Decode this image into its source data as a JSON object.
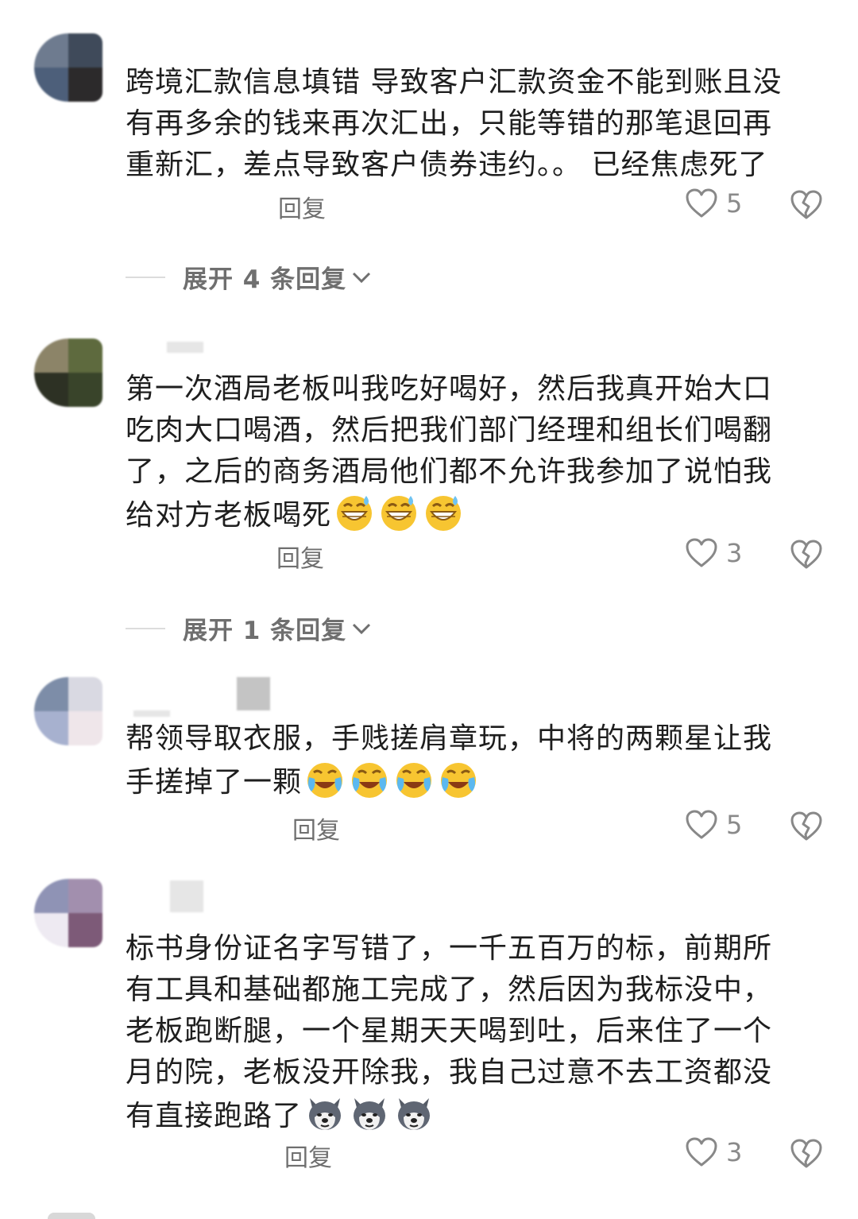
{
  "comments": [
    {
      "text": "跨境汇款信息填错 导致客户汇款资金不能到账且没\n有再多余的钱来再次汇出，只能等错的那笔退回再\n重新汇，差点导致客户债券违约。。 已经焦虑死了",
      "reply_label": "回复",
      "likes": "5",
      "expand_label": "展开 4 条回复"
    },
    {
      "text": "第一次酒局老板叫我吃好喝好，然后我真开始大口\n吃肉大口喝酒，然后把我们部门经理和组长们喝翻\n了，之后的商务酒局他们都不允许我参加了说怕我\n给对方老板喝死",
      "emojis": [
        "grin-sweat-emoji",
        "grin-sweat-emoji",
        "grin-sweat-emoji"
      ],
      "reply_label": "回复",
      "likes": "3",
      "expand_label": "展开 1 条回复"
    },
    {
      "text": "帮领导取衣服，手贱搓肩章玩，中将的两颗星让我\n手搓掉了一颗",
      "emojis": [
        "laugh-cry-emoji",
        "laugh-cry-emoji",
        "laugh-cry-emoji",
        "laugh-cry-emoji"
      ],
      "reply_label": "回复",
      "likes": "5"
    },
    {
      "text": "标书身份证名字写错了，一千五百万的标，前期所\n有工具和基础都施工完成了，然后因为我标没中，\n老板跑断腿，一个星期天天喝到吐，后来住了一个\n月的院，老板没开除我，我自己过意不去工资都没\n有直接跑路了",
      "emojis": [
        "husky-emoji",
        "husky-emoji",
        "husky-emoji"
      ],
      "reply_label": "回复",
      "likes": "3"
    }
  ],
  "colors": {
    "text": "#1e1e1e",
    "meta": "#6f6f6f",
    "icon": "#888888"
  }
}
